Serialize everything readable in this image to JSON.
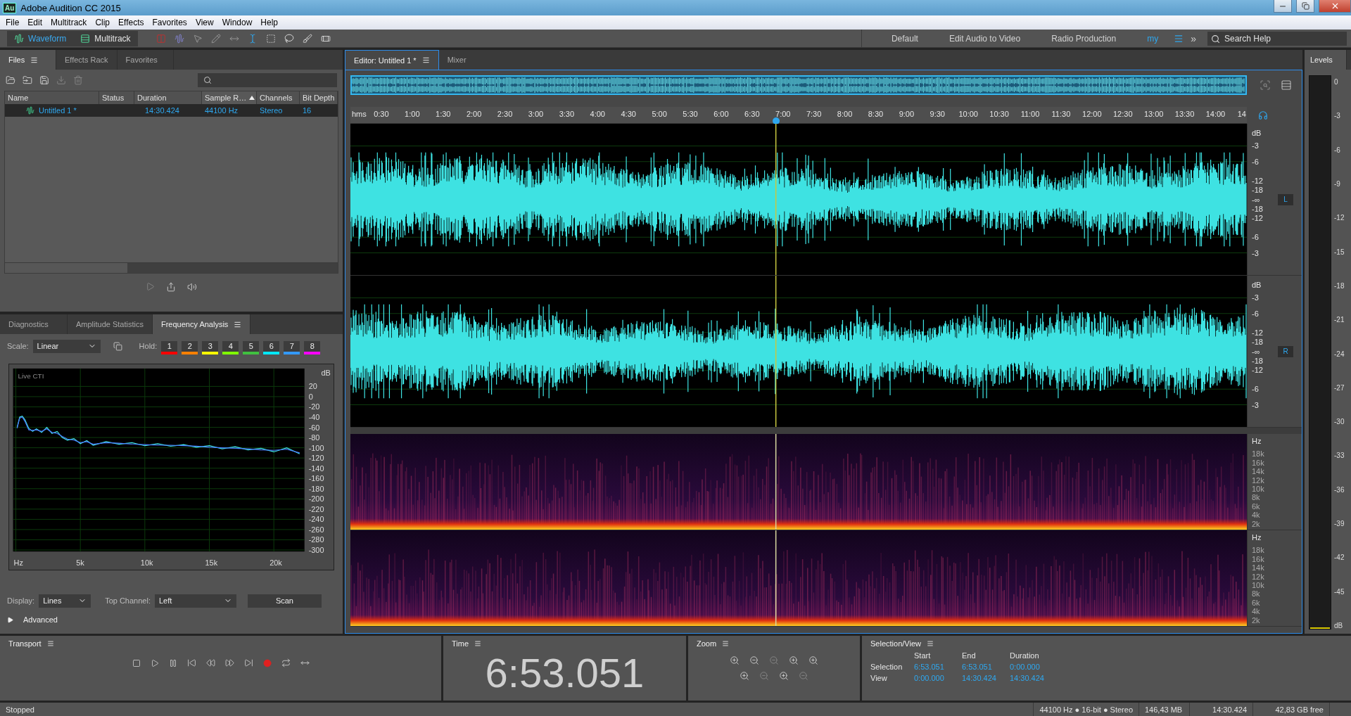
{
  "window": {
    "app_icon": "Au",
    "title": "Adobe Audition CC 2015"
  },
  "menu": [
    "File",
    "Edit",
    "Multitrack",
    "Clip",
    "Effects",
    "Favorites",
    "View",
    "Window",
    "Help"
  ],
  "toolbar": {
    "views": [
      {
        "label": "Waveform",
        "selected": true
      },
      {
        "label": "Multitrack",
        "selected": false
      }
    ],
    "workspaces": [
      {
        "label": "Default",
        "selected": false
      },
      {
        "label": "Edit Audio to Video",
        "selected": false
      },
      {
        "label": "Radio Production",
        "selected": false
      },
      {
        "label": "my",
        "selected": true
      }
    ],
    "overflow": "»",
    "search": {
      "placeholder": "Search Help"
    }
  },
  "files_panel": {
    "tabs": [
      {
        "label": "Files",
        "selected": true
      },
      {
        "label": "Effects Rack",
        "selected": false
      },
      {
        "label": "Favorites",
        "selected": false
      }
    ],
    "columns": [
      {
        "label": "Name",
        "sorted": false
      },
      {
        "label": "Status",
        "sorted": false
      },
      {
        "label": "Duration",
        "sorted": false
      },
      {
        "label": "Sample R…",
        "sorted": true
      },
      {
        "label": "Channels",
        "sorted": false
      },
      {
        "label": "Bit Depth",
        "sorted": false
      }
    ],
    "rows": [
      {
        "name": "Untitled 1 *",
        "duration": "14:30.424",
        "sample_rate": "44100 Hz",
        "channels": "Stereo",
        "bit_depth": "16",
        "selected": true
      }
    ]
  },
  "frequency_panel": {
    "tabs": [
      {
        "label": "Diagnostics",
        "selected": false
      },
      {
        "label": "Amplitude Statistics",
        "selected": false
      },
      {
        "label": "Frequency Analysis",
        "selected": true
      }
    ],
    "scale": {
      "label": "Scale:",
      "value": "Linear"
    },
    "hold": {
      "label": "Hold:",
      "slots": [
        {
          "label": "1",
          "color": "#ff0000"
        },
        {
          "label": "2",
          "color": "#ff8000"
        },
        {
          "label": "3",
          "color": "#ffff00"
        },
        {
          "label": "4",
          "color": "#80ff00"
        },
        {
          "label": "5",
          "color": "#40c040"
        },
        {
          "label": "6",
          "color": "#00e8ff"
        },
        {
          "label": "7",
          "color": "#3399ff"
        },
        {
          "label": "8",
          "color": "#ff00ff"
        }
      ]
    },
    "chart_label": "Live CTI",
    "chart_data": {
      "type": "line",
      "ylabel": "dB",
      "xlim": [
        0,
        22375
      ],
      "ylim": [
        -303,
        55
      ],
      "grid": true,
      "xticks": [
        {
          "value": 0,
          "label": "Hz"
        },
        {
          "value": 5000,
          "label": "5k"
        },
        {
          "value": 10000,
          "label": "10k"
        },
        {
          "value": 15000,
          "label": "15k"
        },
        {
          "value": 20000,
          "label": "20k"
        }
      ],
      "yticks": [
        20,
        0,
        -20,
        -40,
        -60,
        -80,
        -100,
        -120,
        -140,
        -160,
        -180,
        -200,
        -220,
        -240,
        -260,
        -280,
        -300
      ],
      "x": [
        100,
        300,
        500,
        700,
        1000,
        1300,
        1600,
        2000,
        2400,
        2800,
        3200,
        3600,
        4000,
        4500,
        5000,
        5500,
        6000,
        7000,
        8000,
        9000,
        10000,
        11000,
        12000,
        13000,
        14000,
        15000,
        16000,
        17000,
        18000,
        19000,
        20000,
        21000,
        22000
      ],
      "series": [
        {
          "color": "#40e8e8",
          "values": [
            -60,
            -40,
            -38,
            -45,
            -62,
            -68,
            -63,
            -70,
            -60,
            -72,
            -68,
            -80,
            -85,
            -82,
            -92,
            -86,
            -95,
            -88,
            -93,
            -90,
            -96,
            -92,
            -97,
            -94,
            -99,
            -96,
            -102,
            -98,
            -104,
            -101,
            -108,
            -100,
            -112
          ]
        },
        {
          "color": "#4a7aff",
          "values": [
            -62,
            -42,
            -40,
            -48,
            -65,
            -66,
            -65,
            -68,
            -63,
            -70,
            -72,
            -78,
            -83,
            -85,
            -90,
            -88,
            -93,
            -90,
            -91,
            -93,
            -94,
            -95,
            -95,
            -96,
            -97,
            -99,
            -100,
            -101,
            -102,
            -104,
            -105,
            -103,
            -110
          ]
        }
      ]
    },
    "display": {
      "label": "Display:",
      "value": "Lines"
    },
    "top_channel": {
      "label": "Top Channel:",
      "value": "Left"
    },
    "scan_button": "Scan",
    "advanced": {
      "label": "Advanced",
      "expanded": false
    }
  },
  "editor": {
    "tabs": [
      {
        "label": "Editor: Untitled 1 *",
        "selected": true
      },
      {
        "label": "Mixer",
        "selected": false
      }
    ],
    "ruler": [
      "hms",
      "0:30",
      "1:00",
      "1:30",
      "2:00",
      "2:30",
      "3:00",
      "3:30",
      "4:00",
      "4:30",
      "5:00",
      "5:30",
      "6:00",
      "6:30",
      "7:00",
      "7:30",
      "8:00",
      "8:30",
      "9:00",
      "9:30",
      "10:00",
      "10:30",
      "11:00",
      "11:30",
      "12:00",
      "12:30",
      "13:00",
      "13:30",
      "14:00",
      "14"
    ],
    "playhead": {
      "level": 0.4746
    },
    "channels": [
      {
        "label": "L",
        "scale": [
          "dB",
          "-3",
          "-6",
          "-12",
          "-18",
          "-∞",
          "-18",
          "-12",
          "-6",
          "-3"
        ]
      },
      {
        "label": "R",
        "scale": [
          "dB",
          "-3",
          "-6",
          "-12",
          "-18",
          "-∞",
          "-18",
          "-12",
          "-6",
          "-3"
        ]
      }
    ],
    "spectral_scales": [
      [
        "Hz",
        "18k",
        "16k",
        "14k",
        "12k",
        "10k",
        "8k",
        "6k",
        "4k",
        "2k"
      ],
      [
        "Hz",
        "18k",
        "16k",
        "14k",
        "12k",
        "10k",
        "8k",
        "6k",
        "4k",
        "2k"
      ]
    ]
  },
  "levels": {
    "title": "Levels",
    "scale": [
      "0",
      "-3",
      "-6",
      "-9",
      "-12",
      "-15",
      "-18",
      "-21",
      "-24",
      "-27",
      "-30",
      "-33",
      "-36",
      "-39",
      "-42",
      "-45",
      "dB"
    ]
  },
  "transport": {
    "title": "Transport"
  },
  "time": {
    "title": "Time",
    "value": "6:53.051"
  },
  "zoom": {
    "title": "Zoom"
  },
  "selection_view": {
    "title": "Selection/View",
    "columns": [
      "Start",
      "End",
      "Duration"
    ],
    "rows": [
      {
        "label": "Selection",
        "values": [
          "6:53.051",
          "6:53.051",
          "0:00.000"
        ]
      },
      {
        "label": "View",
        "values": [
          "0:00.000",
          "14:30.424",
          "14:30.424"
        ]
      }
    ]
  },
  "status_bar": {
    "state": "Stopped",
    "format": "44100 Hz ● 16-bit ● Stereo",
    "size": "146,43 MB",
    "duration": "14:30.424",
    "free": "42,83 GB free"
  }
}
